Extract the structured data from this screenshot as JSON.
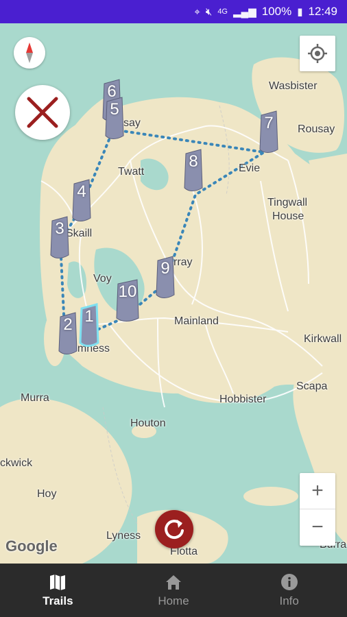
{
  "status_bar": {
    "battery": "100%",
    "time": "12:49",
    "network": "4G"
  },
  "map": {
    "places": [
      {
        "name": "Wasbister"
      },
      {
        "name": "Rousay"
      },
      {
        "name": "say"
      },
      {
        "name": "Twatt"
      },
      {
        "name": "Evie"
      },
      {
        "name": "Tingwall"
      },
      {
        "name": "House"
      },
      {
        "name": "Skaill"
      },
      {
        "name": "rray"
      },
      {
        "name": "Voy"
      },
      {
        "name": "Mainland"
      },
      {
        "name": "omness"
      },
      {
        "name": "Kirkwall"
      },
      {
        "name": "Scapa"
      },
      {
        "name": "Murra"
      },
      {
        "name": "Hobbister"
      },
      {
        "name": "Houton"
      },
      {
        "name": "ckwick"
      },
      {
        "name": "Hoy"
      },
      {
        "name": "Lyness"
      },
      {
        "name": "Flotta"
      },
      {
        "name": "Burra"
      }
    ],
    "stones": [
      "1",
      "2",
      "3",
      "4",
      "5",
      "6",
      "7",
      "8",
      "9",
      "10"
    ],
    "attribution": "Google",
    "zoom_in_label": "+",
    "zoom_out_label": "−"
  },
  "nav": {
    "items": [
      {
        "label": "Trails",
        "icon": "map-icon",
        "active": true
      },
      {
        "label": "Home",
        "icon": "home-icon",
        "active": false
      },
      {
        "label": "Info",
        "icon": "info-icon",
        "active": false
      }
    ]
  },
  "colors": {
    "status_bar": "#4a1fd0",
    "route": "#3a86b8",
    "close_x": "#9b1f1f",
    "refresh": "#9b1f1f",
    "nav_bg": "#2b2b2b"
  }
}
